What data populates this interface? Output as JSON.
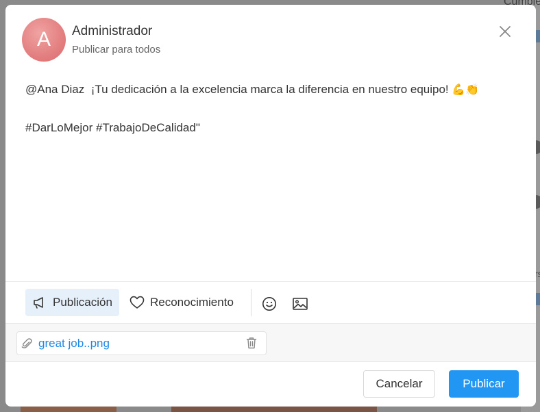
{
  "background": {
    "partial_text_top": "Cumple",
    "partial_text_mid": "rs"
  },
  "modal": {
    "author": {
      "avatar_letter": "A",
      "name": "Administrador",
      "audience": "Publicar para todos"
    },
    "post": {
      "mention": "@Ana  Diaz",
      "message": "¡Tu dedicación a la excelencia marca la diferencia en nuestro equipo!",
      "emojis": "💪👏",
      "hashtags": "#DarLoMejor #TrabajoDeCalidad\""
    },
    "toolbar": {
      "post_type_label": "Publicación",
      "recognition_label": "Reconocimiento",
      "post_type_icon": "megaphone-icon",
      "recognition_icon": "heart-icon",
      "emoji_icon": "smiley-icon",
      "image_icon": "image-icon"
    },
    "attachment": {
      "file_name": "great job..png",
      "clip_icon": "paperclip-icon",
      "delete_icon": "trash-icon"
    },
    "footer": {
      "cancel_label": "Cancelar",
      "publish_label": "Publicar"
    }
  },
  "colors": {
    "accent": "#2196f3",
    "link": "#1e88e5",
    "active_tab_bg": "#e6f0fb",
    "avatar": "#e37f80"
  }
}
